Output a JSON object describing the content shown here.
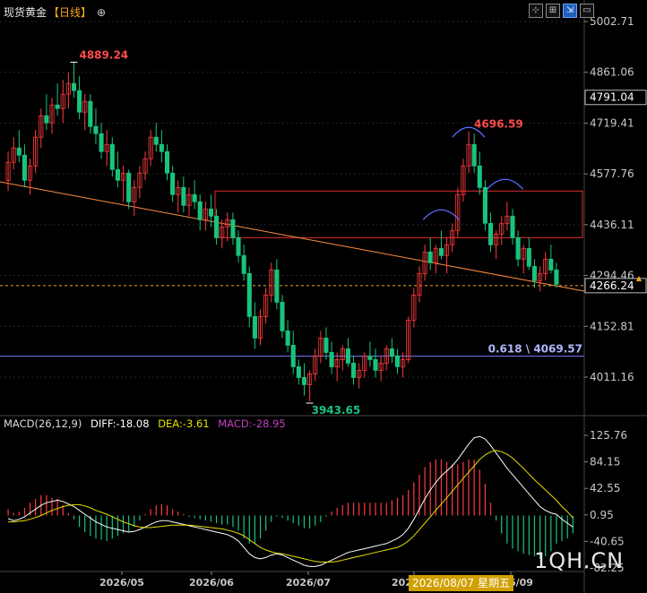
{
  "title": {
    "name": "现货黄金",
    "period": "【日线】",
    "zoom_glyph": "⊕"
  },
  "toolbar": {
    "buttons": [
      "⊹",
      "⊞",
      "⇲",
      "▭"
    ]
  },
  "colors": {
    "bg": "#000000",
    "up": "#ff3b3b",
    "down": "#19c37d",
    "grid": "#262626",
    "axis_text": "#c8c8c8",
    "trendline": "#ff8c42",
    "fib_line": "#7b7bff",
    "box": "#e03030",
    "arc": "#5a6cff",
    "last_price_bg": "#000000",
    "diff": "#ffffff",
    "dea": "#e8e000",
    "macd_label": "#c040c0",
    "cursor_bg": "#d0a000"
  },
  "price_axis": {
    "labels": [
      "5002.71",
      "4861.06",
      "4719.41",
      "4577.76",
      "4436.11",
      "4294.46",
      "4152.81",
      "4011.16"
    ],
    "marked": [
      "4791.04",
      "4266.24"
    ]
  },
  "annotations": {
    "high_1": "4889.24",
    "high_2": "4696.59",
    "low_1": "3943.65",
    "fib": "0.618 \\ 4069.57"
  },
  "macd": {
    "label": "MACD(26,12,9)",
    "diff": "DIFF:-18.08",
    "dea": "DEA:-3.61",
    "macd": "MACD:-28.95",
    "axis_labels": [
      "125.76",
      "84.15",
      "42.55",
      "0.95",
      "-40.65",
      "-82.25"
    ]
  },
  "x_axis": {
    "labels": [
      "2026/05",
      "2026/06",
      "2026/07",
      "2026/08",
      "2026/09"
    ]
  },
  "cursor": {
    "date": "2026/08/07 星期五"
  },
  "watermark": "1QH.CN",
  "chart_data": {
    "type": "candlestick",
    "symbol": "现货黄金",
    "period": "日线",
    "x_range": [
      "2026/04",
      "2026/09"
    ],
    "y_range": [
      3943.65,
      5002.71
    ],
    "candles": [
      [
        4560,
        4640,
        4530,
        4610
      ],
      [
        4610,
        4680,
        4590,
        4650
      ],
      [
        4650,
        4700,
        4610,
        4630
      ],
      [
        4630,
        4660,
        4540,
        4560
      ],
      [
        4560,
        4620,
        4520,
        4600
      ],
      [
        4600,
        4700,
        4580,
        4680
      ],
      [
        4680,
        4760,
        4650,
        4740
      ],
      [
        4740,
        4800,
        4700,
        4720
      ],
      [
        4720,
        4790,
        4690,
        4770
      ],
      [
        4770,
        4830,
        4740,
        4760
      ],
      [
        4760,
        4840,
        4720,
        4800
      ],
      [
        4800,
        4860,
        4760,
        4830
      ],
      [
        4830,
        4889,
        4790,
        4810
      ],
      [
        4810,
        4850,
        4730,
        4750
      ],
      [
        4750,
        4800,
        4700,
        4780
      ],
      [
        4780,
        4800,
        4690,
        4710
      ],
      [
        4710,
        4760,
        4660,
        4690
      ],
      [
        4690,
        4720,
        4620,
        4640
      ],
      [
        4640,
        4700,
        4600,
        4660
      ],
      [
        4660,
        4680,
        4570,
        4590
      ],
      [
        4590,
        4640,
        4540,
        4560
      ],
      [
        4560,
        4600,
        4500,
        4580
      ],
      [
        4580,
        4590,
        4480,
        4500
      ],
      [
        4500,
        4560,
        4460,
        4540
      ],
      [
        4540,
        4600,
        4510,
        4580
      ],
      [
        4580,
        4640,
        4560,
        4620
      ],
      [
        4620,
        4700,
        4600,
        4680
      ],
      [
        4680,
        4720,
        4640,
        4660
      ],
      [
        4660,
        4700,
        4610,
        4640
      ],
      [
        4640,
        4660,
        4560,
        4580
      ],
      [
        4580,
        4600,
        4500,
        4520
      ],
      [
        4520,
        4560,
        4470,
        4540
      ],
      [
        4540,
        4570,
        4470,
        4490
      ],
      [
        4490,
        4540,
        4460,
        4520
      ],
      [
        4520,
        4560,
        4480,
        4500
      ],
      [
        4500,
        4520,
        4420,
        4450
      ],
      [
        4450,
        4500,
        4420,
        4480
      ],
      [
        4480,
        4520,
        4430,
        4460
      ],
      [
        4460,
        4480,
        4380,
        4400
      ],
      [
        4400,
        4450,
        4370,
        4430
      ],
      [
        4430,
        4470,
        4390,
        4450
      ],
      [
        4450,
        4470,
        4380,
        4400
      ],
      [
        4400,
        4420,
        4330,
        4350
      ],
      [
        4350,
        4380,
        4280,
        4300
      ],
      [
        4300,
        4320,
        4150,
        4180
      ],
      [
        4180,
        4220,
        4090,
        4120
      ],
      [
        4120,
        4200,
        4100,
        4180
      ],
      [
        4180,
        4260,
        4160,
        4240
      ],
      [
        4240,
        4330,
        4220,
        4310
      ],
      [
        4310,
        4340,
        4200,
        4220
      ],
      [
        4220,
        4240,
        4120,
        4140
      ],
      [
        4140,
        4170,
        4080,
        4100
      ],
      [
        4100,
        4140,
        4020,
        4040
      ],
      [
        4040,
        4060,
        3990,
        4010
      ],
      [
        4010,
        4050,
        3960,
        3990
      ],
      [
        3990,
        4030,
        3944,
        4020
      ],
      [
        4020,
        4090,
        4000,
        4070
      ],
      [
        4070,
        4140,
        4050,
        4120
      ],
      [
        4120,
        4150,
        4060,
        4080
      ],
      [
        4080,
        4110,
        4020,
        4040
      ],
      [
        4040,
        4080,
        4000,
        4060
      ],
      [
        4060,
        4100,
        4030,
        4090
      ],
      [
        4090,
        4120,
        4040,
        4050
      ],
      [
        4050,
        4070,
        3990,
        4010
      ],
      [
        4010,
        4050,
        3980,
        4030
      ],
      [
        4030,
        4080,
        4010,
        4070
      ],
      [
        4070,
        4110,
        4040,
        4060
      ],
      [
        4060,
        4090,
        4010,
        4030
      ],
      [
        4030,
        4070,
        4000,
        4050
      ],
      [
        4050,
        4100,
        4030,
        4090
      ],
      [
        4090,
        4120,
        4050,
        4070
      ],
      [
        4070,
        4090,
        4020,
        4040
      ],
      [
        4040,
        4080,
        4010,
        4060
      ],
      [
        4060,
        4180,
        4050,
        4170
      ],
      [
        4170,
        4260,
        4150,
        4240
      ],
      [
        4240,
        4320,
        4220,
        4300
      ],
      [
        4300,
        4380,
        4280,
        4360
      ],
      [
        4360,
        4400,
        4310,
        4330
      ],
      [
        4330,
        4380,
        4300,
        4370
      ],
      [
        4370,
        4420,
        4340,
        4350
      ],
      [
        4350,
        4400,
        4300,
        4380
      ],
      [
        4380,
        4440,
        4360,
        4420
      ],
      [
        4420,
        4540,
        4400,
        4520
      ],
      [
        4520,
        4620,
        4500,
        4600
      ],
      [
        4600,
        4696,
        4580,
        4660
      ],
      [
        4660,
        4690,
        4580,
        4600
      ],
      [
        4600,
        4640,
        4520,
        4540
      ],
      [
        4540,
        4560,
        4420,
        4440
      ],
      [
        4440,
        4470,
        4360,
        4380
      ],
      [
        4380,
        4420,
        4340,
        4410
      ],
      [
        4410,
        4460,
        4380,
        4440
      ],
      [
        4440,
        4500,
        4420,
        4460
      ],
      [
        4460,
        4480,
        4380,
        4400
      ],
      [
        4400,
        4420,
        4320,
        4340
      ],
      [
        4340,
        4380,
        4300,
        4370
      ],
      [
        4370,
        4400,
        4310,
        4320
      ],
      [
        4320,
        4340,
        4260,
        4280
      ],
      [
        4280,
        4320,
        4250,
        4300
      ],
      [
        4300,
        4360,
        4280,
        4340
      ],
      [
        4340,
        4380,
        4300,
        4310
      ],
      [
        4310,
        4330,
        4260,
        4270
      ]
    ],
    "lines": {
      "high_label": 4889.24,
      "high_2_label": 4696.59,
      "low_label": 3943.65,
      "fib_level": 4069.57,
      "last_price": 4266.24,
      "marker_price": 4791.04,
      "box": {
        "top": 4530,
        "bottom": 4400
      },
      "trendline": {
        "from": 4540,
        "to": 4240
      }
    },
    "macd_series": {
      "name_diff": "DIFF",
      "name_dea": "DEA",
      "name_macd": "MACD",
      "y_range": [
        -82.25,
        125.76
      ],
      "diff": [
        -5,
        -8,
        -6,
        -2,
        4,
        10,
        16,
        20,
        22,
        24,
        22,
        18,
        14,
        8,
        2,
        -4,
        -10,
        -14,
        -18,
        -20,
        -22,
        -24,
        -26,
        -25,
        -22,
        -18,
        -14,
        -10,
        -8,
        -8,
        -10,
        -12,
        -14,
        -16,
        -18,
        -20,
        -22,
        -24,
        -26,
        -28,
        -30,
        -34,
        -40,
        -50,
        -60,
        -66,
        -68,
        -66,
        -62,
        -60,
        -62,
        -66,
        -70,
        -74,
        -78,
        -80,
        -80,
        -78,
        -74,
        -70,
        -66,
        -62,
        -58,
        -56,
        -54,
        -52,
        -50,
        -48,
        -46,
        -44,
        -40,
        -36,
        -30,
        -20,
        -6,
        10,
        26,
        40,
        52,
        62,
        70,
        78,
        88,
        100,
        112,
        122,
        124,
        120,
        110,
        98,
        86,
        74,
        64,
        54,
        44,
        34,
        24,
        14,
        8,
        4,
        2,
        -6,
        -12,
        -18
      ],
      "dea": [
        -10,
        -10,
        -9,
        -8,
        -6,
        -3,
        0,
        4,
        8,
        11,
        14,
        16,
        17,
        17,
        15,
        12,
        8,
        5,
        2,
        -2,
        -6,
        -10,
        -13,
        -16,
        -18,
        -19,
        -19,
        -18,
        -17,
        -16,
        -15,
        -15,
        -15,
        -15,
        -16,
        -17,
        -18,
        -19,
        -20,
        -21,
        -23,
        -25,
        -28,
        -32,
        -38,
        -44,
        -50,
        -54,
        -57,
        -59,
        -60,
        -62,
        -64,
        -66,
        -68,
        -70,
        -72,
        -73,
        -73,
        -73,
        -72,
        -70,
        -68,
        -66,
        -64,
        -62,
        -60,
        -58,
        -56,
        -54,
        -52,
        -50,
        -46,
        -40,
        -32,
        -22,
        -12,
        -2,
        8,
        18,
        28,
        38,
        48,
        58,
        68,
        78,
        88,
        95,
        100,
        102,
        100,
        96,
        90,
        82,
        74,
        65,
        56,
        48,
        40,
        32,
        24,
        14,
        6,
        -4
      ]
    }
  }
}
